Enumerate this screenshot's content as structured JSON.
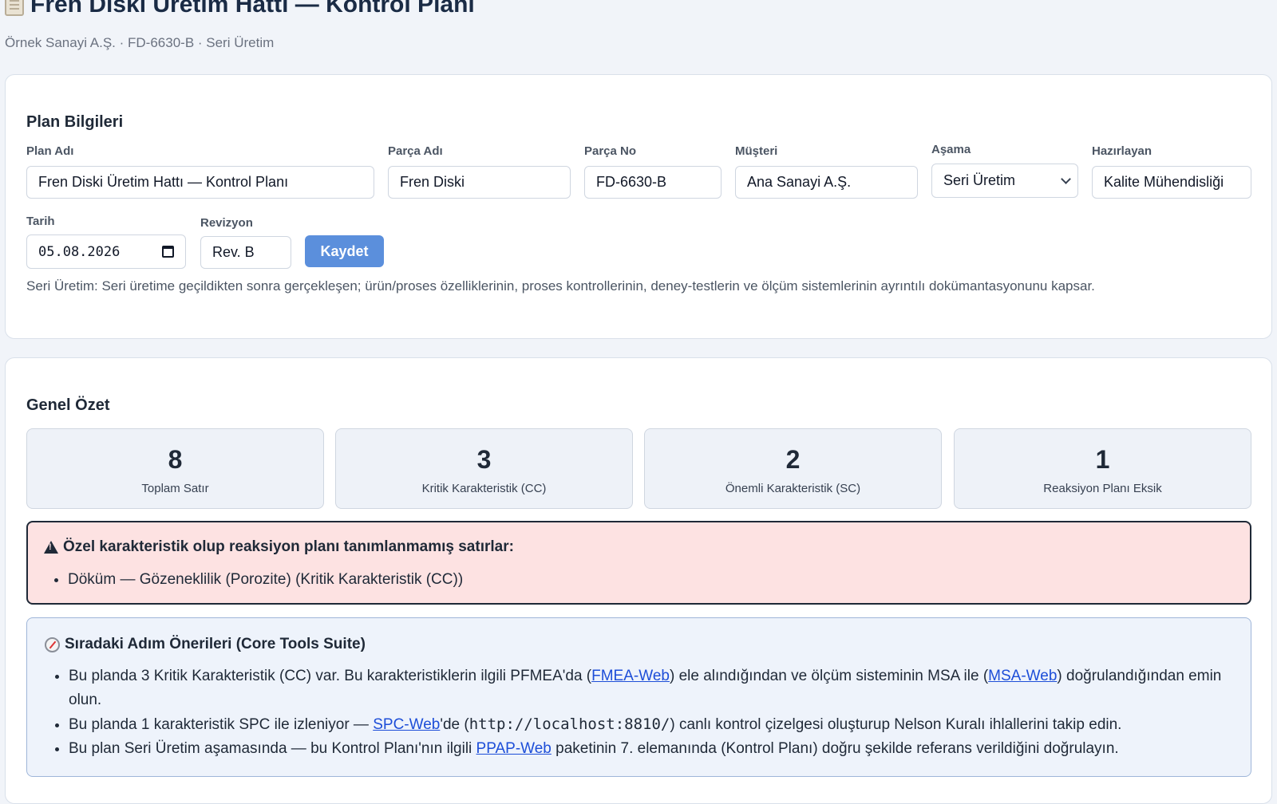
{
  "header": {
    "title": "Fren Diski Üretim Hattı — Kontrol Planı",
    "subtitle": "Örnek Sanayi A.Ş. · FD-6630-B · Seri Üretim"
  },
  "plan_info": {
    "title": "Plan Bilgileri",
    "plan_name": {
      "label": "Plan Adı",
      "value": "Fren Diski Üretim Hattı — Kontrol Planı"
    },
    "part_name": {
      "label": "Parça Adı",
      "value": "Fren Diski"
    },
    "part_no": {
      "label": "Parça No",
      "value": "FD-6630-B"
    },
    "customer": {
      "label": "Müşteri",
      "value": "Ana Sanayi A.Ş."
    },
    "phase": {
      "label": "Aşama",
      "value": "Seri Üretim"
    },
    "prepared_by": {
      "label": "Hazırlayan",
      "value": "Kalite Mühendisliği"
    },
    "date": {
      "label": "Tarih",
      "value": "05.08.2026"
    },
    "revision": {
      "label": "Revizyon",
      "value": "Rev. B"
    },
    "save_label": "Kaydet",
    "phase_note": "Seri Üretim: Seri üretime geçildikten sonra gerçekleşen; ürün/proses özelliklerinin, proses kontrollerinin, deney-testlerin ve ölçüm sistemlerinin ayrıntılı dokümantasyonunu kapsar."
  },
  "summary": {
    "title": "Genel Özet",
    "stats": [
      {
        "value": "8",
        "label": "Toplam Satır"
      },
      {
        "value": "3",
        "label": "Kritik Karakteristik (CC)"
      },
      {
        "value": "2",
        "label": "Önemli Karakteristik (SC)"
      },
      {
        "value": "1",
        "label": "Reaksiyon Planı Eksik"
      }
    ],
    "alert": {
      "title": "Özel karakteristik olup reaksiyon planı tanımlanmamış satırlar:",
      "items": [
        "Döküm — Gözeneklilik (Porozite) (Kritik Karakteristik (CC))"
      ],
      "color": "#fde2e2"
    },
    "next_steps": {
      "title": "Sıradaki Adım Önerileri (Core Tools Suite)",
      "item1": {
        "a": "Bu planda 3 Kritik Karakteristik (CC) var. Bu karakteristiklerin ilgili PFMEA'da (",
        "link1": "FMEA-Web",
        "b": ") ele alındığından ve ölçüm sisteminin MSA ile (",
        "link2": "MSA-Web",
        "c": ") doğrulandığından emin olun."
      },
      "item2": {
        "a": "Bu planda 1 karakteristik SPC ile izleniyor — ",
        "link": "SPC-Web",
        "b": "'de (",
        "code": "http://localhost:8810/",
        "c": ") canlı kontrol çizelgesi oluşturup Nelson Kuralı ihlallerini takip edin."
      },
      "item3": {
        "a": "Bu plan Seri Üretim aşamasında — bu Kontrol Planı'nın ilgili ",
        "link": "PPAP-Web",
        "b": " paketinin 7. elemanında (Kontrol Planı) doğru şekilde referans verildiğini doğrulayın."
      }
    }
  },
  "colors": {
    "accent": "#5b8fdc",
    "link": "#1d4ed8",
    "alert_bg": "#fde2e2",
    "info_bg": "#eef3fb"
  }
}
